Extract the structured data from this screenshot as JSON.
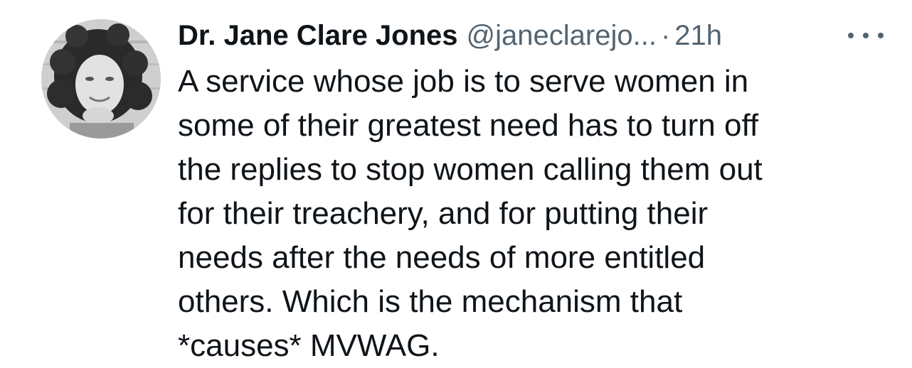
{
  "tweet": {
    "display_name": "Dr. Jane Clare Jones",
    "handle": "@janeclarejo...",
    "separator": "·",
    "timestamp": "21h",
    "more_icon": "more-horizontal-icon",
    "lines": [
      "A service whose job is to serve women in",
      "some of their greatest need has to turn off",
      "the replies to stop women calling them out",
      "for their treachery, and for putting their",
      "needs after the needs of more entitled",
      "others. Which is the mechanism that",
      "*causes* MVWAG."
    ]
  },
  "colors": {
    "primary_text": "#0f1419",
    "secondary_text": "#536471",
    "background": "#ffffff"
  }
}
